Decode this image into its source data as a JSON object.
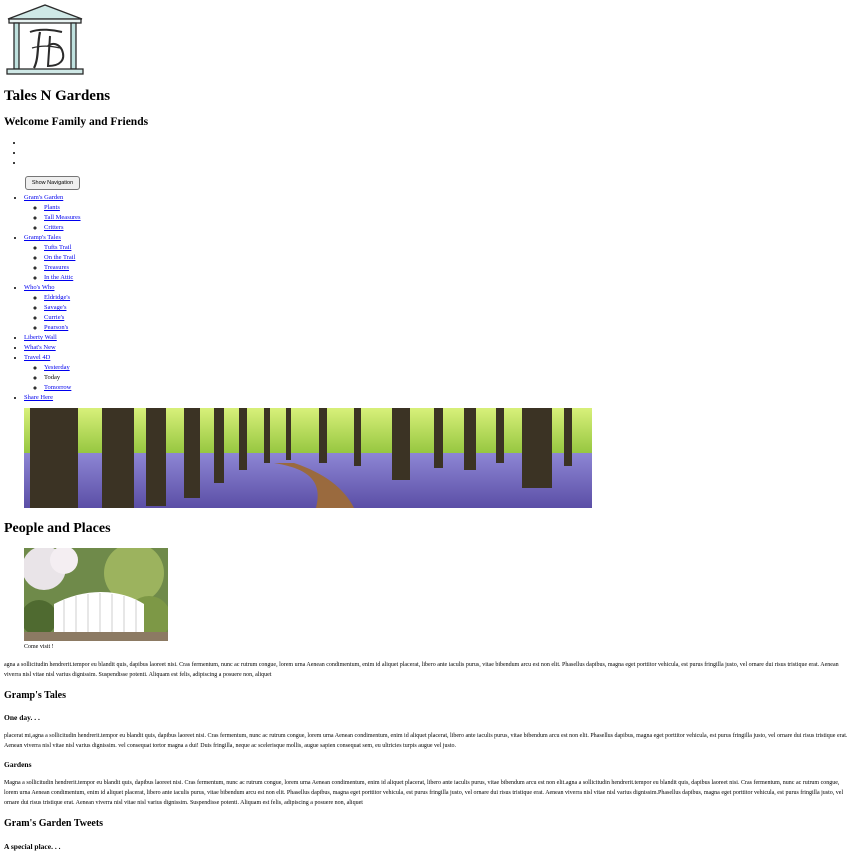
{
  "header": {
    "title": "Tales N Gardens",
    "subtitle": "Welcome Family and Friends"
  },
  "nav": {
    "toggle_label": "Show Navigation",
    "empty_items": 3,
    "menu": [
      {
        "label": "Gram's Garden",
        "children": [
          "Plants",
          "Tall Measures",
          "Critters"
        ]
      },
      {
        "label": "Gramp's Tales",
        "children": [
          "Tufts Trail",
          "On the Trail",
          "Treasures",
          "In the Attic"
        ]
      },
      {
        "label": "Who's Who",
        "children": [
          "Eldridge's",
          "Savage's",
          "Currie's",
          "Pearson's"
        ]
      },
      {
        "label": "Liberty Wall",
        "children": []
      },
      {
        "label": "What's New",
        "children": []
      },
      {
        "label": "Travel 4D",
        "children": [
          "Yesterday",
          "Today",
          "Tomorrow"
        ]
      },
      {
        "label": "Share Here",
        "children": []
      }
    ],
    "unlinked": [
      "Today"
    ]
  },
  "people": {
    "heading": "People and Places",
    "caption": "Come visit !",
    "text": "agna a sollicitudin hendrerit.tempor eu blandit quis, dapibus laoreet nisi. Cras fermentum, nunc ac rutrum congue, lorem urna Aenean condimentum, enim id aliquet placerat, libero ante iaculis purus, vitae bibendum arcu est non elit. Phasellus dapibus, magna eget porttitor vehicula, est purus fringilla justo, vel ornare dui risus tristique erat. Aenean viverra nisl vitae nisl varius dignissim. Suspendisse potenti. Aliquam est felis, adipiscing a posuere non, aliquet"
  },
  "tales": {
    "heading": "Gramp's Tales",
    "one_day": "One day. . .",
    "text1": "placerat mi,agna a sollicitudin hendrerit.tempor eu blandit quis, dapibus laoreet nisi. Cras fermentum, nunc ac rutrum congue, lorem urna Aenean condimentum, enim id aliquet placerat, libero ante iaculis purus, vitae bibendum arcu est non elit. Phasellus dapibus, magna eget porttitor vehicula, est purus fringilla justo, vel ornare dui risus tristique erat. Aenean viverra nisl vitae nisl varius dignissim. vel consequat tortor magna a dui! Duis fringilla, neque ac scelerisque mollis, augue sapien consequat sem, eu ultricies turpis augue vel justo.",
    "gardens_heading": "Gardens",
    "text2": "Magna a sollicitudin hendrerit.tempor eu blandit quis, dapibus laoreet nisi. Cras fermentum, nunc ac rutrum congue, lorem urna Aenean condimentum, enim id aliquet placerat, libero ante iaculis purus, vitae bibendum arcu est non elit.agna a sollicitudin hendrerit.tempor eu blandit quis, dapibus laoreet nisi. Cras fermentum, nunc ac rutrum congue, lorem urna Aenean condimentum, enim id aliquet placerat, libero ante iaculis purus, vitae bibendum arcu est non elit. Phasellus dapibus, magna eget porttitor vehicula, est purus fringilla justo, vel ornare dui risus tristique erat. Aenean viverra nisl vitae nisl varius dignissim.Phasellus dapibus, magna eget porttitor vehicula, est purus fringilla justo, vel ornare dui risus tristique erat. Aenean viverra nisl vitae nisl varius dignissim. Suspendisse potenti. Aliquam est felis, adipiscing a posuere non, aliquet"
  },
  "tweets": {
    "heading": "Gram's Garden Tweets",
    "special": "A special place. . ."
  },
  "colors": {
    "link": "#0000ee",
    "logo_teal": "#6fb8b4"
  },
  "icons": {
    "logo": "tng-house-monogram-icon"
  }
}
